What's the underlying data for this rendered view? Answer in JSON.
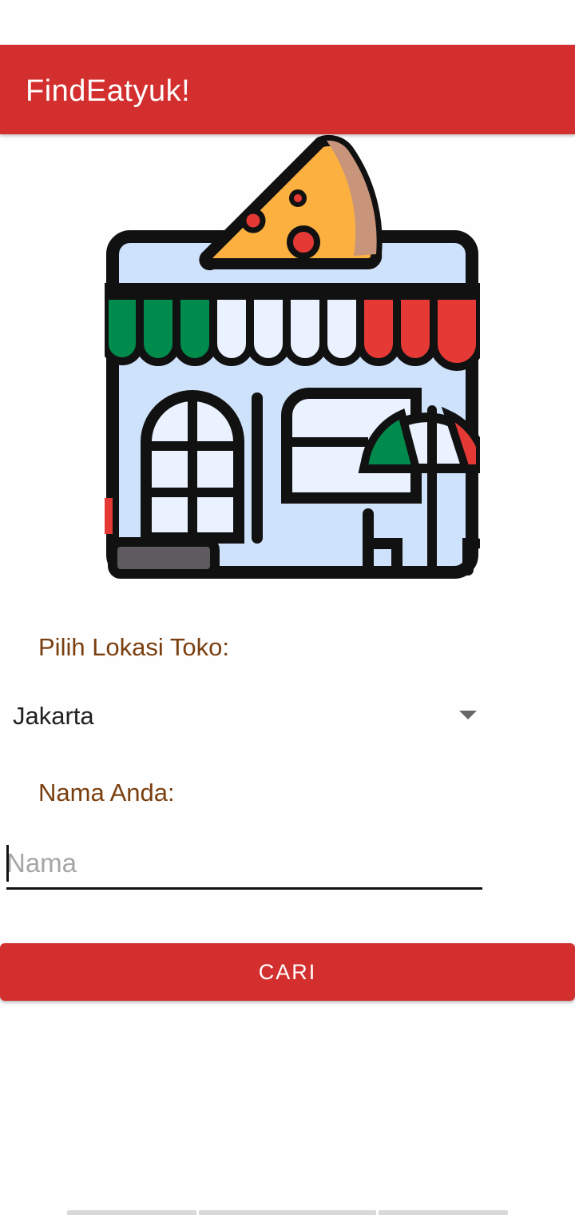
{
  "app_bar": {
    "title": "FindEatyuk!"
  },
  "illustration": {
    "icon": "pizza-store-icon"
  },
  "location": {
    "label": "Pilih Lokasi Toko:",
    "selected": "Jakarta",
    "icon": "dropdown-arrow-icon"
  },
  "name": {
    "label": "Nama Anda:",
    "placeholder": "Nama",
    "value": ""
  },
  "search_button": {
    "label": "CARI"
  },
  "colors": {
    "primary": "#d32f2f",
    "label_text": "#7b3f0f",
    "awning_green": "#008a4b",
    "awning_red": "#e53935",
    "pizza_yellow": "#fbb040"
  }
}
